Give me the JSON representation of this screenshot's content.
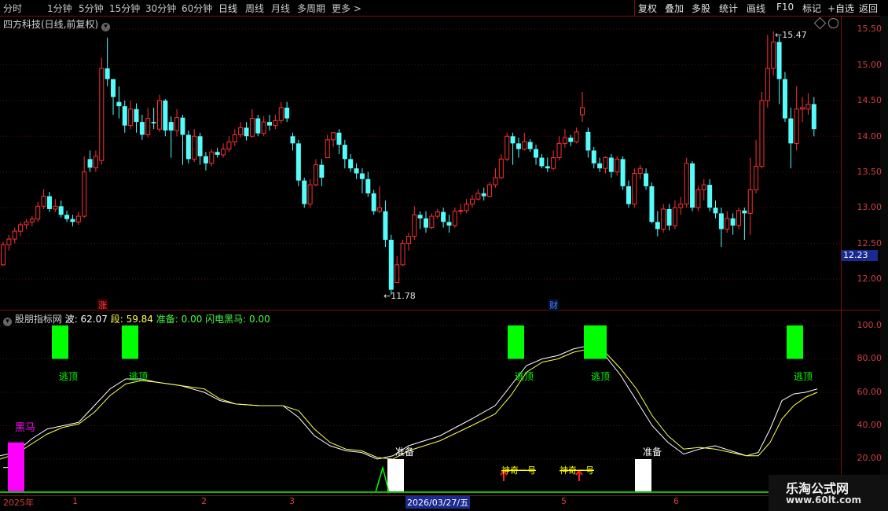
{
  "toolbar": {
    "periods": [
      "分时",
      "1分钟",
      "5分钟",
      "15分钟",
      "30分钟",
      "60分钟",
      "日线",
      "周线",
      "月线",
      "多周期",
      "更多 >"
    ],
    "active_period": "日线",
    "actions": [
      "复权",
      "叠加",
      "多股",
      "统计",
      "画线",
      "F10",
      "标记",
      "+自选",
      "返回"
    ]
  },
  "stock": {
    "title": "四方科技(日线,前复权)",
    "current_price": "12.23",
    "high_label": "15.47",
    "low_label": "11.78"
  },
  "price_axis": [
    "15.50",
    "15.00",
    "14.50",
    "14.00",
    "13.50",
    "13.00",
    "12.50",
    "12.00"
  ],
  "markers": {
    "zhang": "涨",
    "cai": "财"
  },
  "indicator": {
    "name": "股朋指标网",
    "bo_label": "波: 62.07",
    "duan_label": "段: 59.84",
    "zhunbei_label": "准备: 0.00",
    "heima_label": "闪电黑马: 0.00",
    "axis": [
      "100.0",
      "80.00",
      "60.00",
      "40.00",
      "20.00"
    ],
    "escape_top": "逃顶",
    "dark_horse": "黑马",
    "ready": "准备",
    "signal_text": "神奇一号",
    "signal_text_2": "神奇一号"
  },
  "dates": [
    "2025年",
    "1",
    "2",
    "3",
    "2026/03/27/五",
    "5",
    "6"
  ],
  "watermark": {
    "name": "乐淘公式网",
    "url": "www.60lt.com"
  },
  "colors": {
    "up": "#ff3030",
    "down": "#54fcfc",
    "bo": "#ffffff",
    "duan": "#ffff54",
    "escape": "#00ff00",
    "horse": "#ff00ff"
  },
  "candles": [
    [
      12.2,
      12.48,
      12.52,
      12.18
    ],
    [
      12.48,
      12.56,
      12.62,
      12.4
    ],
    [
      12.56,
      12.67,
      12.72,
      12.5
    ],
    [
      12.67,
      12.76,
      12.8,
      12.6
    ],
    [
      12.76,
      12.8,
      12.84,
      12.7
    ],
    [
      12.8,
      12.84,
      12.88,
      12.74
    ],
    [
      12.84,
      13.02,
      13.08,
      12.8
    ],
    [
      13.02,
      13.16,
      13.26,
      12.98
    ],
    [
      13.16,
      12.98,
      13.22,
      12.94
    ],
    [
      12.98,
      13.02,
      13.12,
      12.94
    ],
    [
      13.02,
      12.9,
      13.1,
      12.86
    ],
    [
      12.9,
      12.84,
      12.96,
      12.8
    ],
    [
      12.84,
      12.8,
      12.9,
      12.74
    ],
    [
      12.8,
      12.88,
      12.94,
      12.76
    ],
    [
      12.88,
      13.5,
      13.72,
      12.86
    ],
    [
      13.68,
      13.56,
      13.8,
      13.5
    ],
    [
      13.56,
      13.72,
      13.8,
      13.5
    ],
    [
      13.66,
      14.95,
      15.1,
      13.6
    ],
    [
      14.95,
      14.8,
      15.38,
      14.7
    ],
    [
      14.8,
      14.55,
      14.7,
      14.3
    ],
    [
      14.48,
      14.42,
      14.7,
      14.25
    ],
    [
      14.42,
      14.15,
      14.5,
      14.05
    ],
    [
      14.15,
      14.38,
      14.5,
      14.1
    ],
    [
      14.38,
      14.2,
      14.46,
      14.05
    ],
    [
      14.2,
      14.02,
      14.3,
      13.95
    ],
    [
      14.02,
      14.25,
      14.4,
      13.98
    ],
    [
      14.2,
      14.18,
      14.4,
      14.1
    ],
    [
      14.1,
      14.5,
      14.58,
      14.06
    ],
    [
      14.5,
      14.08,
      14.52,
      14.0
    ],
    [
      14.2,
      14.08,
      14.28,
      13.7
    ],
    [
      14.08,
      14.26,
      14.38,
      14.0
    ],
    [
      14.26,
      14.02,
      14.3,
      13.6
    ],
    [
      14.02,
      13.68,
      14.08,
      13.62
    ],
    [
      13.68,
      14.0,
      14.1,
      13.64
    ],
    [
      14.0,
      13.72,
      14.05,
      13.6
    ],
    [
      13.72,
      13.62,
      13.78,
      13.52
    ],
    [
      13.62,
      13.78,
      13.82,
      13.58
    ],
    [
      13.78,
      13.74,
      13.84,
      13.7
    ],
    [
      13.74,
      13.82,
      13.9,
      13.7
    ],
    [
      13.82,
      13.92,
      14.0,
      13.78
    ],
    [
      13.92,
      14.02,
      14.1,
      13.86
    ],
    [
      14.02,
      14.12,
      14.2,
      13.98
    ],
    [
      14.12,
      14.0,
      14.2,
      13.94
    ],
    [
      14.0,
      14.25,
      14.38,
      13.98
    ],
    [
      14.25,
      14.04,
      14.3,
      14.0
    ],
    [
      14.04,
      14.2,
      14.28,
      14.0
    ],
    [
      14.2,
      14.15,
      14.3,
      14.08
    ],
    [
      14.15,
      14.22,
      14.3,
      14.1
    ],
    [
      14.22,
      14.4,
      14.48,
      14.18
    ],
    [
      14.4,
      14.25,
      14.48,
      14.2
    ],
    [
      14.0,
      13.9,
      14.05,
      13.8
    ],
    [
      13.9,
      13.38,
      13.95,
      13.3
    ],
    [
      13.38,
      13.05,
      13.42,
      13.0
    ],
    [
      13.05,
      13.32,
      13.4,
      13.0
    ],
    [
      13.32,
      13.6,
      13.68,
      13.3
    ],
    [
      13.6,
      13.42,
      13.68,
      13.3
    ],
    [
      13.7,
      13.95,
      14.02,
      13.7
    ],
    [
      13.95,
      14.05,
      14.05,
      13.85
    ],
    [
      14.05,
      13.88,
      14.1,
      13.75
    ],
    [
      13.88,
      13.68,
      13.95,
      13.55
    ],
    [
      13.68,
      13.55,
      13.75,
      13.5
    ],
    [
      13.55,
      13.48,
      13.62,
      13.4
    ],
    [
      13.48,
      13.4,
      13.55,
      13.2
    ],
    [
      13.4,
      13.2,
      13.5,
      13.15
    ],
    [
      13.2,
      12.95,
      13.25,
      12.9
    ],
    [
      12.95,
      13.0,
      13.3,
      12.92
    ],
    [
      12.95,
      12.55,
      13.1,
      12.45
    ],
    [
      12.55,
      11.85,
      12.62,
      11.78
    ],
    [
      11.95,
      12.2,
      12.32,
      11.95
    ],
    [
      12.2,
      12.5,
      12.55,
      12.18
    ],
    [
      12.5,
      12.6,
      12.65,
      12.4
    ],
    [
      12.6,
      12.9,
      13.02,
      12.55
    ],
    [
      12.9,
      12.85,
      12.95,
      12.7
    ],
    [
      12.85,
      12.72,
      12.95,
      12.65
    ],
    [
      12.72,
      12.88,
      12.92,
      12.7
    ],
    [
      12.88,
      12.94,
      12.98,
      12.85
    ],
    [
      12.94,
      12.8,
      13.0,
      12.72
    ],
    [
      12.8,
      12.75,
      12.9,
      12.65
    ],
    [
      12.75,
      12.95,
      13.0,
      12.72
    ],
    [
      12.95,
      12.96,
      13.05,
      12.9
    ],
    [
      12.96,
      13.05,
      13.12,
      12.92
    ],
    [
      13.05,
      13.12,
      13.18,
      13.0
    ],
    [
      13.12,
      13.2,
      13.26,
      13.1
    ],
    [
      13.2,
      13.16,
      13.28,
      13.1
    ],
    [
      13.16,
      13.32,
      13.36,
      13.14
    ],
    [
      13.32,
      13.42,
      13.55,
      13.28
    ],
    [
      13.42,
      13.68,
      13.75,
      13.4
    ],
    [
      13.68,
      14.0,
      14.05,
      13.65
    ],
    [
      14.0,
      13.9,
      14.05,
      13.6
    ],
    [
      13.9,
      13.82,
      13.98,
      13.7
    ],
    [
      13.82,
      13.92,
      14.05,
      13.8
    ],
    [
      13.92,
      13.82,
      13.96,
      13.78
    ],
    [
      13.82,
      13.7,
      13.88,
      13.6
    ],
    [
      13.7,
      13.58,
      13.75,
      13.55
    ],
    [
      13.58,
      13.55,
      13.7,
      13.5
    ],
    [
      13.55,
      13.7,
      13.8,
      13.52
    ],
    [
      13.7,
      13.9,
      14.0,
      13.66
    ],
    [
      13.9,
      13.98,
      14.1,
      13.84
    ],
    [
      13.98,
      13.92,
      14.02,
      13.86
    ],
    [
      13.92,
      14.06,
      14.12,
      13.9
    ],
    [
      14.3,
      14.4,
      14.62,
      14.2
    ],
    [
      14.06,
      13.8,
      14.12,
      13.7
    ],
    [
      13.8,
      13.62,
      13.85,
      13.55
    ],
    [
      13.62,
      13.55,
      13.7,
      13.5
    ],
    [
      13.55,
      13.7,
      13.72,
      13.48
    ],
    [
      13.7,
      13.5,
      13.75,
      13.42
    ],
    [
      13.5,
      13.68,
      13.72,
      13.45
    ],
    [
      13.68,
      13.3,
      13.72,
      13.25
    ],
    [
      13.3,
      13.05,
      13.38,
      13.0
    ],
    [
      13.05,
      13.48,
      13.55,
      13.0
    ],
    [
      13.48,
      13.55,
      13.6,
      13.4
    ],
    [
      13.48,
      13.3,
      13.55,
      13.25
    ],
    [
      13.3,
      12.8,
      13.35,
      12.78
    ],
    [
      12.8,
      12.7,
      12.95,
      12.6
    ],
    [
      12.7,
      12.98,
      13.05,
      12.65
    ],
    [
      12.98,
      12.75,
      13.05,
      12.68
    ],
    [
      12.75,
      13.0,
      13.1,
      12.7
    ],
    [
      13.0,
      13.05,
      13.15,
      12.9
    ],
    [
      13.05,
      13.62,
      13.7,
      13.0
    ],
    [
      13.62,
      13.0,
      13.65,
      12.95
    ],
    [
      13.0,
      13.25,
      13.3,
      12.95
    ],
    [
      13.25,
      13.32,
      13.4,
      13.1
    ],
    [
      13.32,
      13.0,
      13.4,
      12.95
    ],
    [
      13.0,
      12.92,
      13.1,
      12.85
    ],
    [
      12.92,
      12.7,
      13.0,
      12.45
    ],
    [
      12.7,
      12.85,
      12.95,
      12.65
    ],
    [
      12.85,
      12.75,
      12.92,
      12.62
    ],
    [
      12.75,
      12.96,
      13.0,
      12.7
    ],
    [
      12.96,
      12.92,
      13.0,
      12.55
    ],
    [
      12.92,
      13.25,
      13.7,
      12.62
    ],
    [
      13.25,
      13.58,
      13.95,
      13.2
    ],
    [
      13.58,
      14.5,
      14.62,
      13.55
    ],
    [
      14.5,
      14.95,
      15.42,
      14.4
    ],
    [
      14.95,
      15.32,
      15.47,
      14.85
    ],
    [
      15.32,
      14.8,
      15.4,
      14.45
    ],
    [
      14.8,
      14.25,
      14.9,
      14.2
    ],
    [
      14.25,
      13.9,
      14.4,
      13.55
    ],
    [
      13.9,
      14.38,
      14.7,
      13.8
    ],
    [
      14.38,
      14.4,
      14.55,
      14.2
    ],
    [
      14.38,
      14.45,
      14.6,
      14.3
    ],
    [
      14.45,
      14.1,
      14.55,
      14.0
    ]
  ]
}
